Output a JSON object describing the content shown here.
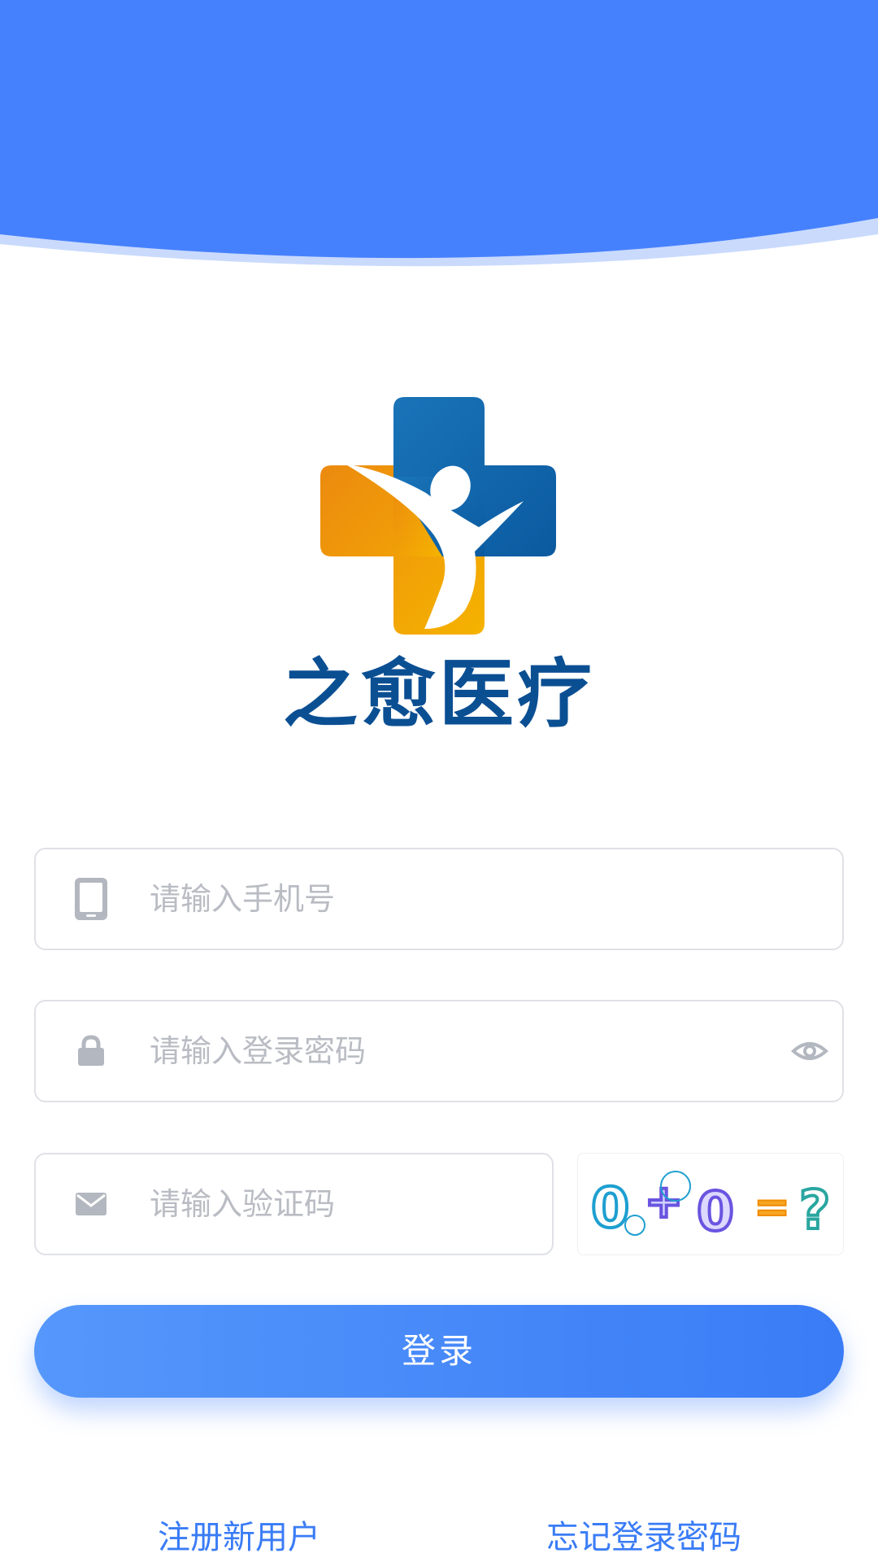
{
  "brand": {
    "name": "之愈医疗"
  },
  "form": {
    "phone": {
      "placeholder": "请输入手机号",
      "value": ""
    },
    "password": {
      "placeholder": "请输入登录密码",
      "value": ""
    },
    "captcha": {
      "placeholder": "请输入验证码",
      "value": "",
      "image_text": "0+0=?"
    }
  },
  "actions": {
    "login_label": "登录",
    "register_label": "注册新用户",
    "forgot_label": "忘记登录密码"
  },
  "icons": {
    "phone": "phone-icon",
    "lock": "lock-icon",
    "mail": "mail-icon",
    "eye": "eye-icon"
  },
  "colors": {
    "primary": "#3a7cf6",
    "header": "#4681fd",
    "brand_text": "#0b4f93",
    "placeholder": "#b9bcc3"
  }
}
